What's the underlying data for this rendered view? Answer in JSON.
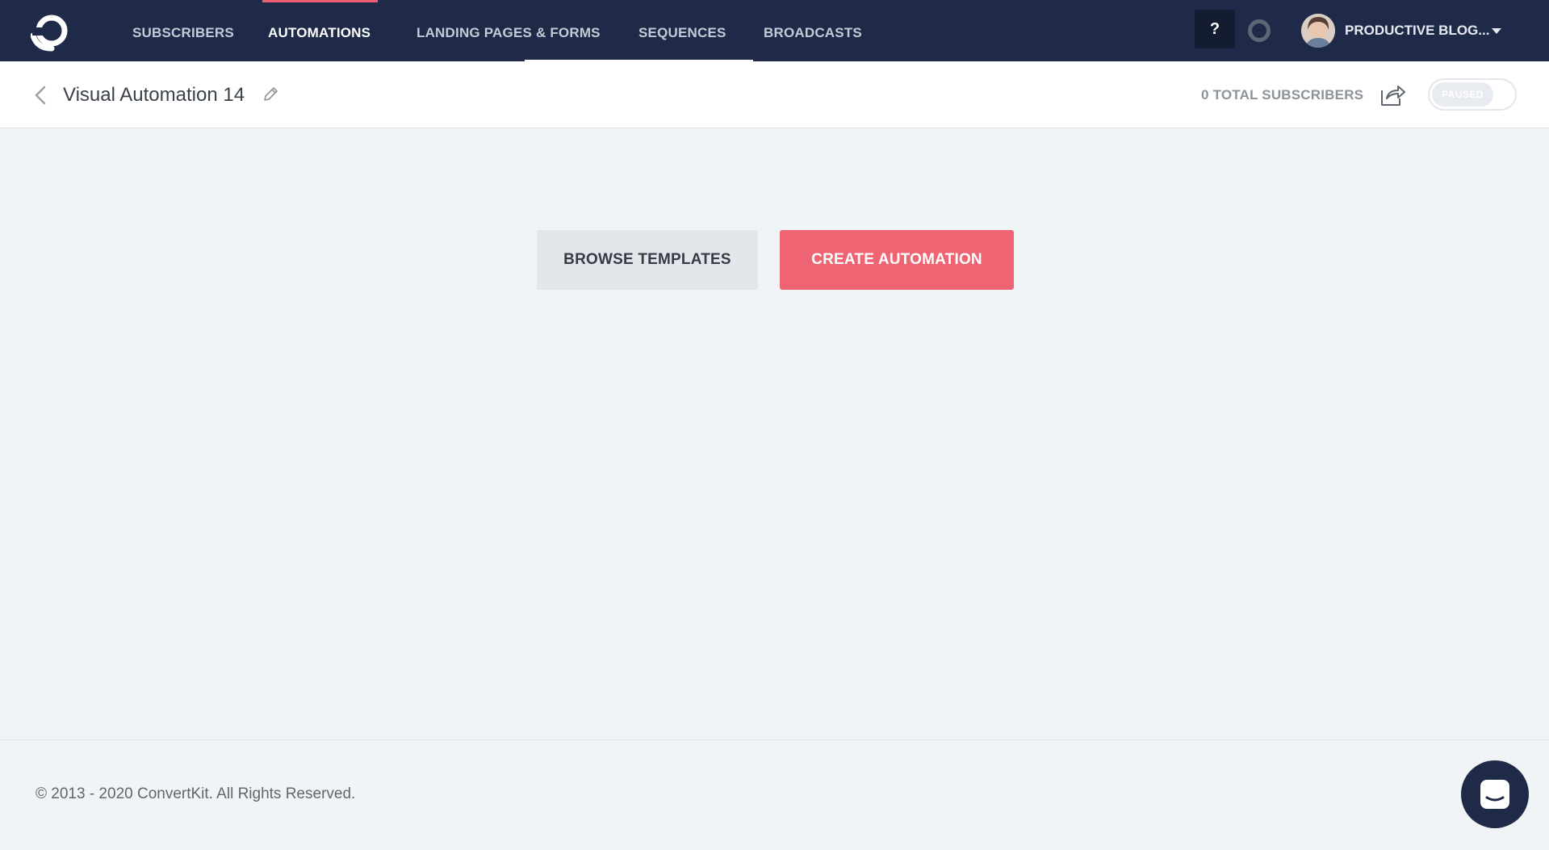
{
  "nav": {
    "items": [
      {
        "label": "SUBSCRIBERS",
        "active": false
      },
      {
        "label": "AUTOMATIONS",
        "active": true
      },
      {
        "label": "LANDING PAGES & FORMS",
        "active": false
      },
      {
        "label": "SEQUENCES",
        "active": false
      },
      {
        "label": "BROADCASTS",
        "active": false
      }
    ],
    "help_label": "?",
    "account_name": "PRODUCTIVE BLOG...",
    "active_color": "#ee5f73",
    "bg_color": "#1e2a48"
  },
  "header": {
    "title": "Visual Automation 14",
    "total_subscribers": "0 TOTAL SUBSCRIBERS",
    "status_label": "PAUSED"
  },
  "main": {
    "browse_label": "BROWSE TEMPLATES",
    "create_label": "CREATE AUTOMATION",
    "create_color": "#ee6473"
  },
  "footer": {
    "copyright": "© 2013 - 2020 ConvertKit. All Rights Reserved."
  },
  "icons": [
    "convertkit-logo-icon",
    "help-icon",
    "status-ring-icon",
    "caret-down-icon",
    "back-arrow-icon",
    "pencil-icon",
    "share-icon",
    "chat-icon"
  ]
}
